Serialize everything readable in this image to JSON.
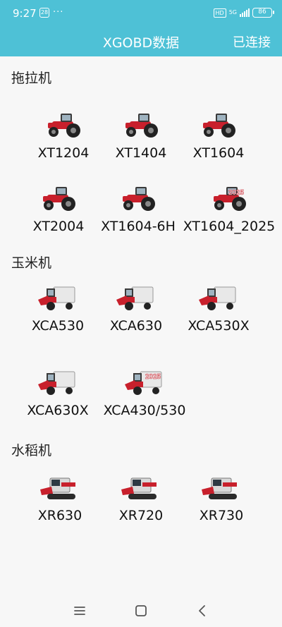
{
  "status_bar": {
    "time": "9:27",
    "notif_icon_label": "28",
    "more": "···",
    "hd": "HD",
    "network": "5G",
    "battery": "86"
  },
  "app_bar": {
    "title": "XGOBD数据",
    "connection_status": "已连接"
  },
  "sections": [
    {
      "title": "拖拉机",
      "items": [
        {
          "label": "XT1204",
          "icon": "tractor-icon"
        },
        {
          "label": "XT1404",
          "icon": "tractor-icon"
        },
        {
          "label": "XT1604",
          "icon": "tractor-icon"
        },
        {
          "label": "XT2004",
          "icon": "tractor-icon"
        },
        {
          "label": "XT1604-6H",
          "icon": "tractor-icon"
        },
        {
          "label": "XT1604_2025",
          "icon": "tractor-2025-icon"
        }
      ]
    },
    {
      "title": "玉米机",
      "items": [
        {
          "label": "XCA530",
          "icon": "corn-harvester-icon"
        },
        {
          "label": "XCA630",
          "icon": "corn-harvester-icon"
        },
        {
          "label": "XCA530X",
          "icon": "corn-harvester-icon"
        },
        {
          "label": "XCA630X",
          "icon": "corn-harvester-icon"
        },
        {
          "label": "XCA430/530",
          "icon": "corn-harvester-2025-icon"
        }
      ]
    },
    {
      "title": "水稻机",
      "items": [
        {
          "label": "XR630",
          "icon": "rice-harvester-icon"
        },
        {
          "label": "XR720",
          "icon": "rice-harvester-icon"
        },
        {
          "label": "XR730",
          "icon": "rice-harvester-icon"
        }
      ]
    }
  ],
  "year_badge": "2025",
  "colors": {
    "accent": "#4ec1d6",
    "machine_red": "#c8202c",
    "background": "#f7f7f7"
  }
}
